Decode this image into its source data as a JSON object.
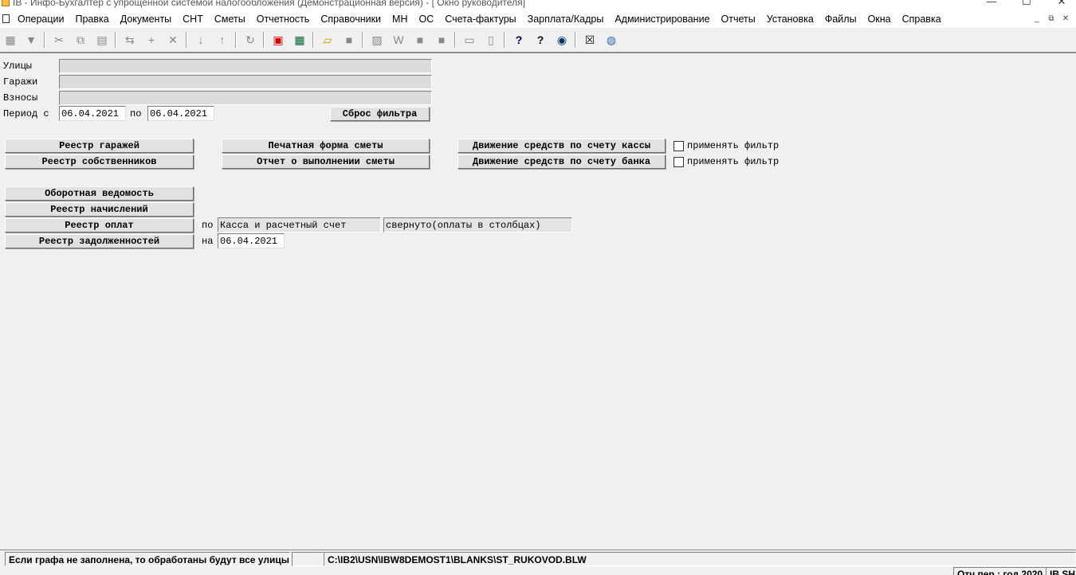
{
  "window": {
    "title": "IB - Инфо-Бухгалтер с упрощенной системой налогообложения (Демонстрационная версия) - [  Окно руководителя]",
    "minimize": "—",
    "maximize": "☐",
    "close": "✕"
  },
  "menu": {
    "items": [
      "Операции",
      "Правка",
      "Документы",
      "СНТ",
      "Сметы",
      "Отчетность",
      "Справочники",
      "МН",
      "ОС",
      "Счета-фактуры",
      "Зарплата/Кадры",
      "Администрирование",
      "Отчеты",
      "Установка",
      "Файлы",
      "Окна",
      "Справка"
    ],
    "mdi_minimize": "_",
    "mdi_restore": "⧉",
    "mdi_close": "✕"
  },
  "toolbar": {
    "icons": [
      {
        "name": "grid-view-icon",
        "glyph": "▦",
        "active": true
      },
      {
        "name": "filter-icon",
        "glyph": "▼",
        "active": true
      },
      {
        "name": "cut-icon",
        "glyph": "✂",
        "active": false
      },
      {
        "name": "copy-icon",
        "glyph": "⧉",
        "active": false
      },
      {
        "name": "paste-icon",
        "glyph": "▤",
        "active": false
      },
      {
        "name": "reverse-icon",
        "glyph": "⇆",
        "active": false
      },
      {
        "name": "add-icon",
        "glyph": "+",
        "active": false
      },
      {
        "name": "delete-icon",
        "glyph": "✕",
        "active": false
      },
      {
        "name": "sort-az-icon",
        "glyph": "↓",
        "active": false
      },
      {
        "name": "sort-za-icon",
        "glyph": "↑",
        "active": false
      },
      {
        "name": "refresh-icon",
        "glyph": "↻",
        "active": false
      },
      {
        "name": "pdf-icon",
        "glyph": "▣",
        "active": true
      },
      {
        "name": "calculator-icon",
        "glyph": "▦",
        "active": true
      },
      {
        "name": "open-folder-icon",
        "glyph": "▱",
        "active": true
      },
      {
        "name": "save-icon",
        "glyph": "■",
        "active": false
      },
      {
        "name": "export-icon",
        "glyph": "▨",
        "active": false
      },
      {
        "name": "word-icon",
        "glyph": "W",
        "active": false
      },
      {
        "name": "excel-icon",
        "glyph": "■",
        "active": false
      },
      {
        "name": "table-icon",
        "glyph": "■",
        "active": false
      },
      {
        "name": "printer-icon",
        "glyph": "▭",
        "active": false
      },
      {
        "name": "preview-icon",
        "glyph": "▯",
        "active": false
      },
      {
        "name": "help-icon",
        "glyph": "?",
        "active": true
      },
      {
        "name": "context-help-icon",
        "glyph": "?",
        "active": true
      },
      {
        "name": "compass-icon",
        "glyph": "◉",
        "active": true
      },
      {
        "name": "close-window-icon",
        "glyph": "☒",
        "active": true
      },
      {
        "name": "globe-icon",
        "glyph": "◍",
        "active": true
      }
    ]
  },
  "filters": {
    "streets_label": "Улицы",
    "streets_value": "",
    "garages_label": "Гаражи",
    "garages_value": "",
    "fees_label": "Взносы",
    "fees_value": "",
    "period_label": "Период с",
    "period_from": "06.04.2021",
    "period_to_label": "по",
    "period_to": "06.04.2021",
    "reset_button": "Сброс фильтра"
  },
  "reports": {
    "garages_registry": "Реестр гаражей",
    "owners_registry": "Реестр собственников",
    "estimate_print_form": "Печатная форма сметы",
    "estimate_execution_report": "Отчет о выполнении сметы",
    "cash_account_movement": "Движение средств по счету кассы",
    "bank_account_movement": "Движение средств по счету банка",
    "apply_filter_cash": "применять фильтр",
    "apply_filter_bank": "применять фильтр",
    "turnover_statement": "Оборотная ведомость",
    "accruals_registry": "Реестр начислений",
    "payments_registry": "Реестр оплат",
    "debts_registry": "Реестр задолженностей",
    "payments_by_label": "по",
    "payments_by_value": "Касса и расчетный счет",
    "payments_view_value": "свернуто(оплаты в столбцах)",
    "debts_on_label": "на",
    "debts_on_date": "06.04.2021"
  },
  "status": {
    "hint": "Если графа не заполнена, то обработаны будут все улицы",
    "empty": "",
    "file_path": "C:\\IB2\\USN\\IBW8DEMOST1\\BLANKS\\ST_RUKOVOD.BLW",
    "period": "Отч.пер.: год 2020",
    "db": "IB SH"
  }
}
